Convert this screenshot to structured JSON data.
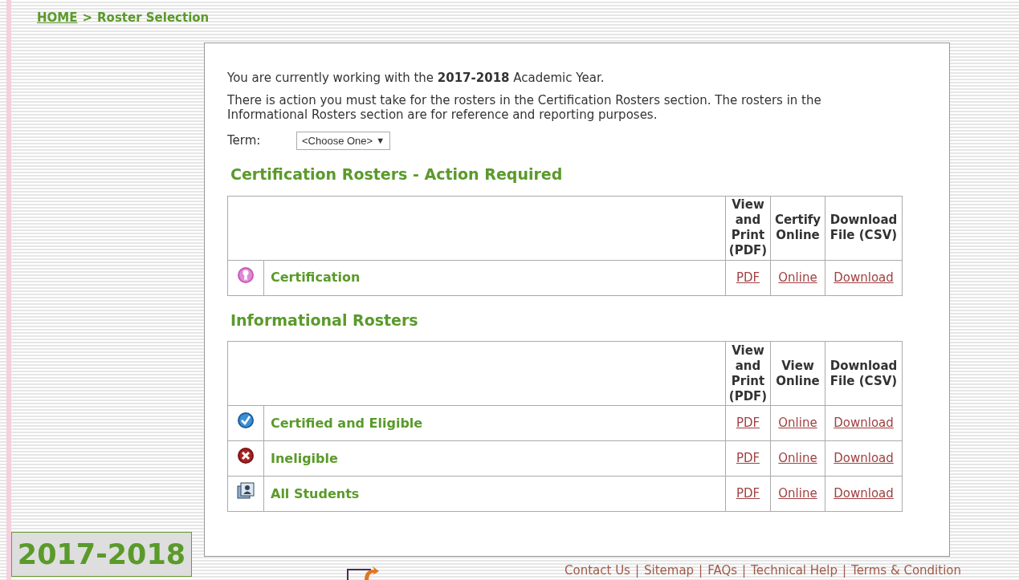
{
  "breadcrumb": {
    "home": "HOME",
    "separator": ">",
    "current": "Roster Selection"
  },
  "intro": {
    "year_sentence": "You are currently working with the **2017-2018** Academic Year.",
    "action_sentence": "There is action you must take for the rosters in the Certification Rosters section. The rosters in the Informational Rosters section are for reference and reporting purposes."
  },
  "term": {
    "label": "Term:",
    "value": "<Choose One>",
    "caret": "▼"
  },
  "sections": [
    {
      "title": "Certification Rosters - Action Required",
      "columns": [
        "View and Print (PDF)",
        "Certify Online",
        "Download File (CSV)"
      ],
      "rows": [
        {
          "kind": "certificate",
          "name": "Certification",
          "links": [
            "PDF",
            "Online",
            "Download"
          ]
        }
      ]
    },
    {
      "title": "Informational Rosters",
      "columns": [
        "View and Print (PDF)",
        "View Online",
        "Download File (CSV)"
      ],
      "rows": [
        {
          "kind": "check",
          "name": "Certified and Eligible",
          "links": [
            "PDF",
            "Online",
            "Download"
          ]
        },
        {
          "kind": "cross",
          "name": "Ineligible",
          "links": [
            "PDF",
            "Online",
            "Download"
          ]
        },
        {
          "kind": "students",
          "name": "All Students",
          "links": [
            "PDF",
            "Online",
            "Download"
          ]
        }
      ]
    }
  ],
  "year_badge": "2017-2018",
  "footer_links": [
    "Contact Us",
    "Sitemap",
    "FAQs",
    "Technical Help",
    "Terms & Condition"
  ],
  "footer_separator": "|"
}
